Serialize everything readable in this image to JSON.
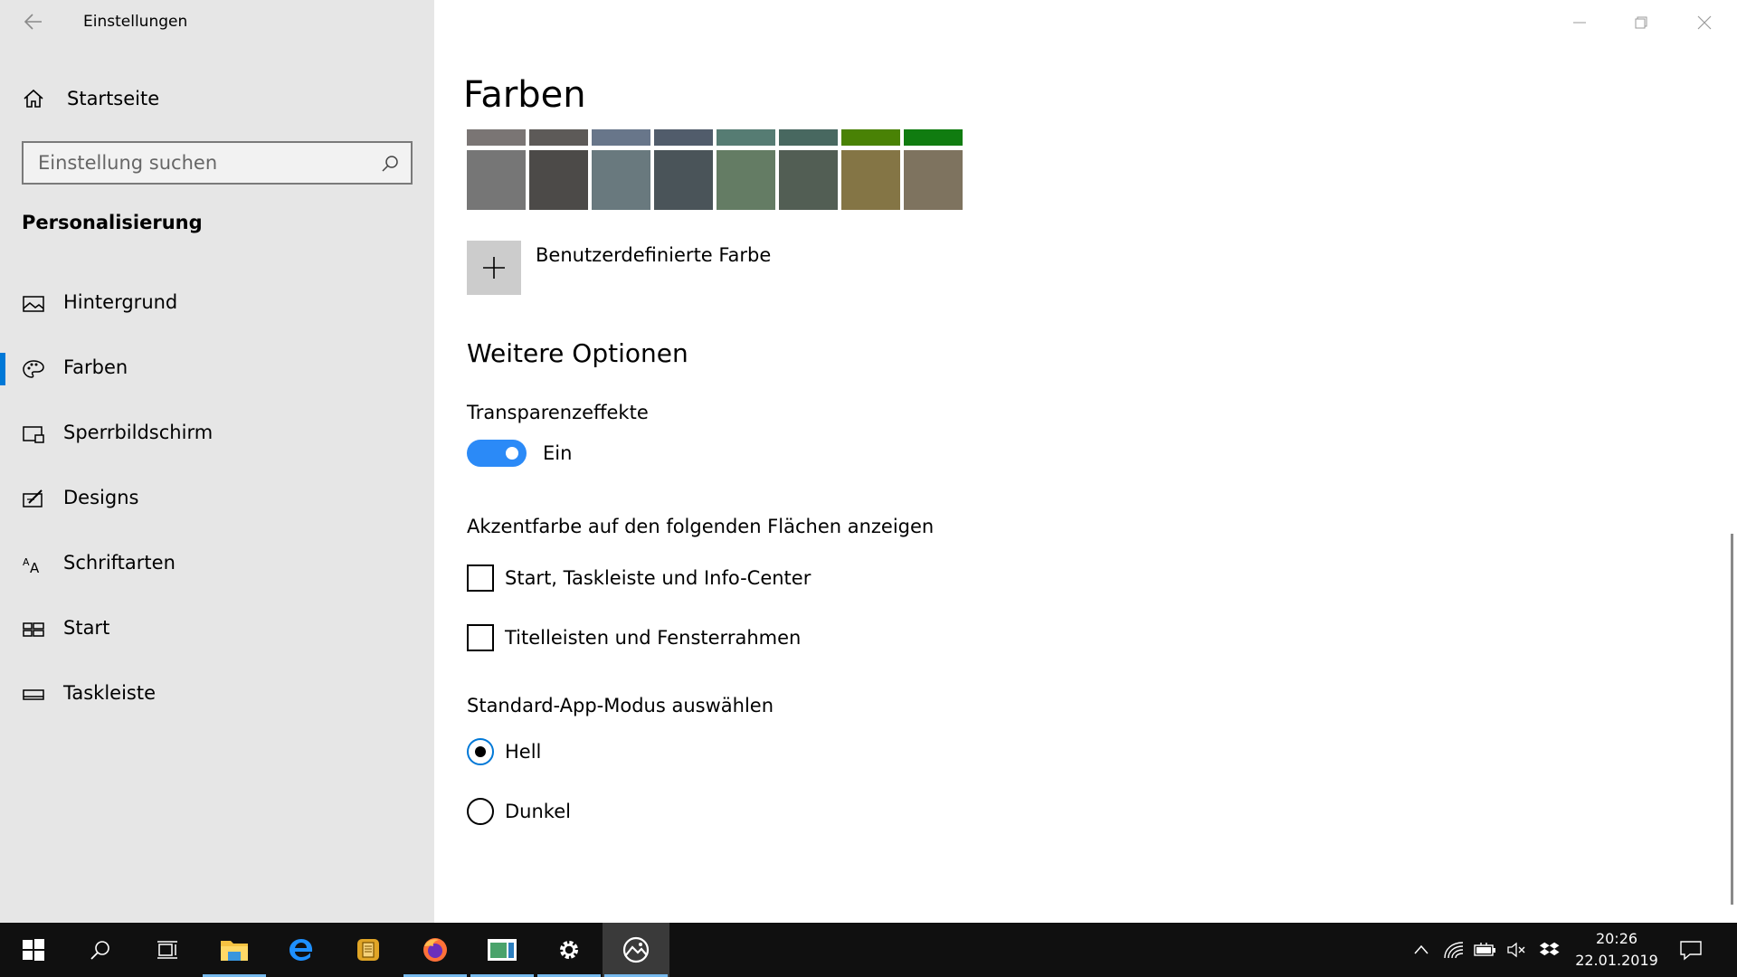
{
  "window": {
    "title": "Einstellungen"
  },
  "sidebar": {
    "home_label": "Startseite",
    "search_placeholder": "Einstellung suchen",
    "section_title": "Personalisierung",
    "items": [
      {
        "label": "Hintergrund",
        "icon": "image-icon"
      },
      {
        "label": "Farben",
        "icon": "palette-icon",
        "active": true
      },
      {
        "label": "Sperrbildschirm",
        "icon": "lock-screen-icon"
      },
      {
        "label": "Designs",
        "icon": "designs-icon"
      },
      {
        "label": "Schriftarten",
        "icon": "fonts-icon"
      },
      {
        "label": "Start",
        "icon": "start-layout-icon"
      },
      {
        "label": "Taskleiste",
        "icon": "taskbar-icon"
      }
    ]
  },
  "main": {
    "title": "Farben",
    "swatches_top": [
      "#7a7574",
      "#5d5a58",
      "#68768a",
      "#515c6b",
      "#567c73",
      "#486860",
      "#498205",
      "#107c10"
    ],
    "swatches_bottom": [
      "#767676",
      "#4c4a48",
      "#69797e",
      "#4a5459",
      "#647c64",
      "#525e54",
      "#847545",
      "#7e735f"
    ],
    "custom_color_label": "Benutzerdefinierte Farbe",
    "more_options_title": "Weitere Optionen",
    "transparency_label": "Transparenzeffekte",
    "transparency_state": "Ein",
    "accent_surfaces_label": "Akzentfarbe auf den folgenden Flächen anzeigen",
    "checkbox_start": "Start, Taskleiste und Info-Center",
    "checkbox_titlebars": "Titelleisten und Fensterrahmen",
    "app_mode_label": "Standard-App-Modus auswählen",
    "mode_light": "Hell",
    "mode_dark": "Dunkel"
  },
  "taskbar": {
    "time": "20:26",
    "date": "22.01.2019"
  },
  "colors": {
    "accent": "#0078d7",
    "toggle_on": "#2b8af7",
    "sidebar_bg": "#e6e6e6",
    "taskbar_bg": "#101010"
  }
}
